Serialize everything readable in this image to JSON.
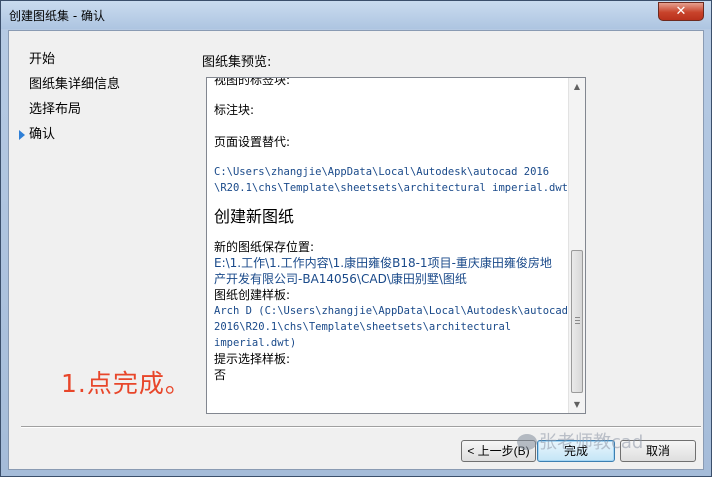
{
  "window": {
    "title": "创建图纸集 - 确认",
    "close_label": "✕"
  },
  "nav": {
    "items": [
      {
        "label": "开始"
      },
      {
        "label": "图纸集详细信息"
      },
      {
        "label": "选择布局"
      },
      {
        "label": "确认",
        "active": true
      }
    ]
  },
  "preview": {
    "label": "图纸集预览:",
    "lines": {
      "view_label_block": "视图的标签块:",
      "callout_block": "标注块:",
      "page_setup": "页面设置替代:",
      "page_setup_path_1": "C:\\Users\\zhangjie\\AppData\\Local\\Autodesk\\autocad 2016",
      "page_setup_path_2": "\\R20.1\\chs\\Template\\sheetsets\\architectural imperial.dwt",
      "new_sheets_heading": "创建新图纸",
      "save_location_label": "新的图纸保存位置:",
      "save_location_1": "E:\\1.工作\\1.工作内容\\1.康田雍俊B18-1项目-重庆康田雍俊房地",
      "save_location_2": "产开发有限公司-BA14056\\CAD\\康田别墅\\图纸",
      "template_label": "图纸创建样板:",
      "template_1": "Arch D (C:\\Users\\zhangjie\\AppData\\Local\\Autodesk\\autocad",
      "template_2": "2016\\R20.1\\chs\\Template\\sheetsets\\architectural",
      "template_3": "imperial.dwt)",
      "prompt_label": "提示选择样板:",
      "prompt_value": "否"
    }
  },
  "annotation": "1.点完成。",
  "buttons": {
    "back": "< 上一步(B)",
    "finish": "完成",
    "cancel": "取消"
  },
  "watermark": "张老师教cad",
  "colors": {
    "accent": "#2f7fd6",
    "annotation": "#e8462a",
    "path_text": "#1a4a8a"
  }
}
